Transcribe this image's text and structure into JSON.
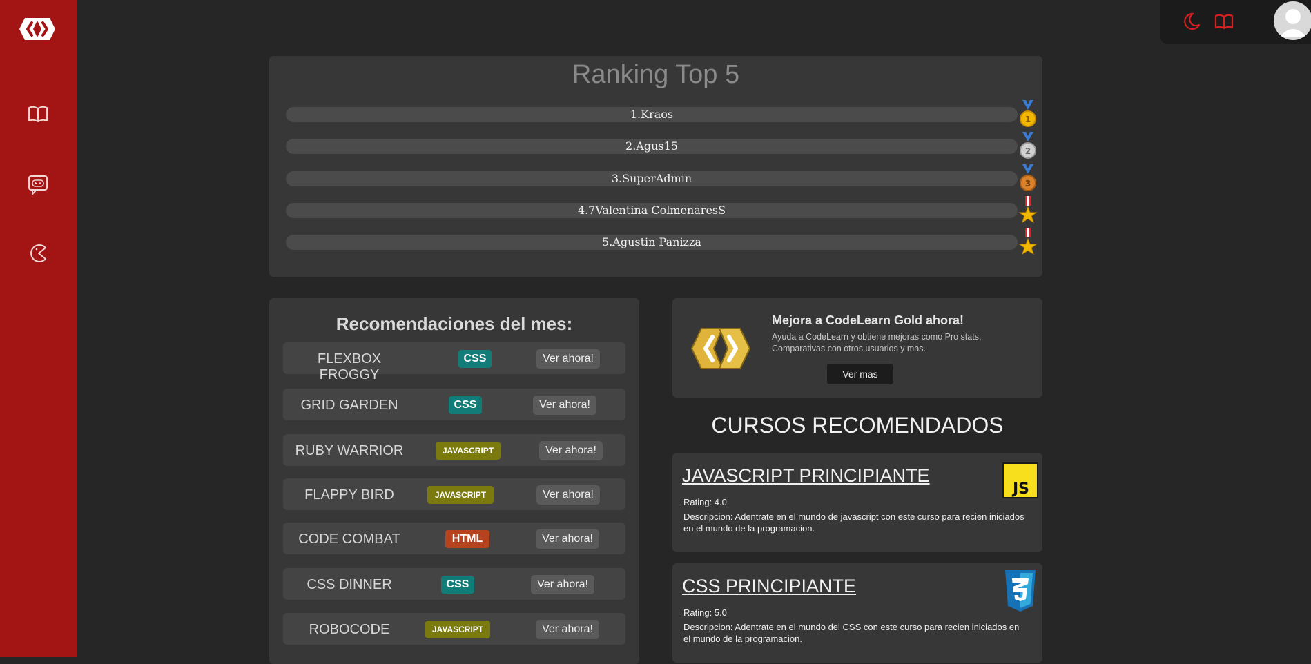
{
  "sidebar": {
    "logo_icon": "codelearn-logo-icon",
    "items": [
      {
        "icon": "book-icon"
      },
      {
        "icon": "gamepad-chat-icon"
      },
      {
        "icon": "pacman-icon"
      }
    ]
  },
  "topbar": {
    "icons": [
      "moon-icon",
      "book-icon"
    ],
    "avatar": "user-avatar-icon"
  },
  "ranking": {
    "title": "Ranking Top 5",
    "entries": [
      {
        "label": "1.Kraos",
        "medal": "gold-medal-icon"
      },
      {
        "label": "2.Agus15",
        "medal": "silver-medal-icon"
      },
      {
        "label": "3.SuperAdmin",
        "medal": "bronze-medal-icon"
      },
      {
        "label": "4.7Valentina ColmenaresS",
        "medal": "military-medal-icon"
      },
      {
        "label": "5.Agustin Panizza",
        "medal": "military-medal-icon"
      }
    ]
  },
  "recommendations": {
    "title": "Recomendaciones del mes:",
    "items": [
      {
        "name": "FLEXBOX FROGGY",
        "tag": "CSS",
        "button": "Ver ahora!"
      },
      {
        "name": "GRID GARDEN",
        "tag": "CSS",
        "button": "Ver ahora!"
      },
      {
        "name": "RUBY WARRIOR",
        "tag": "JAVASCRIPT",
        "button": "Ver ahora!"
      },
      {
        "name": "FLAPPY BIRD",
        "tag": "JAVASCRIPT",
        "button": "Ver ahora!"
      },
      {
        "name": "CODE COMBAT",
        "tag": "HTML",
        "button": "Ver ahora!"
      },
      {
        "name": "CSS DINNER",
        "tag": "CSS",
        "button": "Ver ahora!"
      },
      {
        "name": "ROBOCODE",
        "tag": "JAVASCRIPT",
        "button": "Ver ahora!"
      }
    ]
  },
  "promo": {
    "title": "Mejora a CodeLearn Gold ahora!",
    "description": "Ayuda a CodeLearn y obtiene mejoras como Pro stats, Comparativas con otros usuarios y mas.",
    "button": "Ver mas",
    "logo_icon": "codelearn-gold-logo-icon"
  },
  "courses": {
    "title": "CURSOS RECOMENDADOS",
    "items": [
      {
        "name": "JAVASCRIPT PRINCIPIANTE",
        "rating": "Rating: 4.0",
        "description": "Descripcion: Adentrate en el mundo de javascript con este curso para recien iniciados en el mundo de la programacion.",
        "icon": "javascript-logo-icon"
      },
      {
        "name": "CSS PRINCIPIANTE",
        "rating": "Rating: 5.0",
        "description": "Descripcion: Adentrate en el mundo del CSS con este curso para recien iniciados en el mundo de la programacion.",
        "icon": "css3-logo-icon"
      }
    ]
  },
  "colors": {
    "sidebar": "#a31515",
    "background": "#262626",
    "card": "#373737",
    "accent": "#d61f1f",
    "gold": "#e0b43a"
  }
}
